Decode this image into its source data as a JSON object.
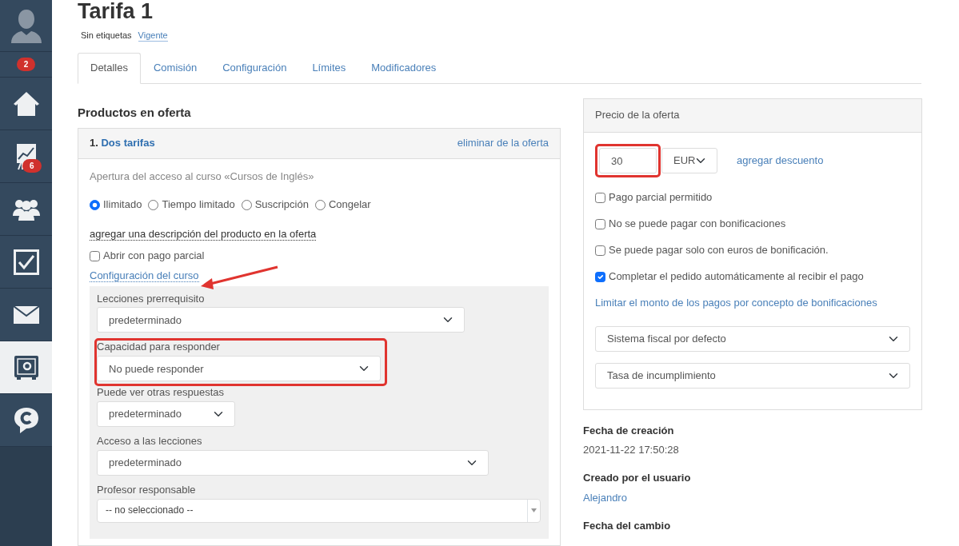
{
  "sidebar": {
    "items": [
      {
        "kind": "avatar",
        "selected": false
      },
      {
        "kind": "counter",
        "badge": "2",
        "selected": false
      },
      {
        "kind": "home",
        "selected": false
      },
      {
        "kind": "chart",
        "badge": "6",
        "selected": false
      },
      {
        "kind": "people",
        "selected": false
      },
      {
        "kind": "tasks",
        "selected": false
      },
      {
        "kind": "mail",
        "selected": false
      },
      {
        "kind": "safe",
        "selected": true
      },
      {
        "kind": "chat",
        "selected": false
      }
    ]
  },
  "title": "Tarifa 1",
  "tags": {
    "label": "Sin etiquetas",
    "status": "Vigente"
  },
  "tabs": [
    {
      "label": "Detalles",
      "selected": true
    },
    {
      "label": "Comisión",
      "selected": false
    },
    {
      "label": "Configuración",
      "selected": false
    },
    {
      "label": "Límites",
      "selected": false
    },
    {
      "label": "Modificadores",
      "selected": false
    }
  ],
  "products": {
    "heading": "Productos en oferta",
    "offer": {
      "number": "1.",
      "name": "Dos tarifas",
      "remove": "eliminar de la oferta",
      "access_text": "Apertura del acceso al curso «Cursos de Inglés»",
      "options": [
        {
          "label": "Ilimitado",
          "selected": true
        },
        {
          "label": "Tiempo limitado",
          "selected": false
        },
        {
          "label": "Suscripción",
          "selected": false
        },
        {
          "label": "Congelar",
          "selected": false
        }
      ],
      "description_link": "agregar una descripción del producto en la oferta",
      "partial": {
        "label": "Abrir con pago parcial",
        "checked": false
      },
      "settings_link": "Configuración del curso",
      "settings": [
        {
          "label": "Lecciones prerrequisito",
          "value": "predeterminado",
          "kind": "select",
          "highlighted": false
        },
        {
          "label": "Capacidad para responder",
          "value": "No puede responder",
          "kind": "select",
          "highlighted": true
        },
        {
          "label": "Puede ver otras respuestas",
          "value": "predeterminado",
          "kind": "select",
          "highlighted": false
        },
        {
          "label": "Acceso a las lecciones",
          "value": "predeterminado",
          "kind": "select",
          "highlighted": false
        },
        {
          "label": "Profesor responsable",
          "value": "-- no seleccionado --",
          "kind": "combo",
          "highlighted": false
        }
      ]
    }
  },
  "price": {
    "heading": "Precio de la oferta",
    "amount": "30",
    "highlighted": true,
    "currency": "EUR",
    "discount_link": "agregar descuento",
    "checks": [
      {
        "label": "Pago parcial permitido",
        "checked": false
      },
      {
        "label": "No se puede pagar con bonificaciones",
        "checked": false
      },
      {
        "label": "Se puede pagar solo con euros de bonificación.",
        "checked": false
      },
      {
        "label": "Completar el pedido automáticamente al recibir el pago",
        "checked": true
      }
    ],
    "limit_link": "Limitar el monto de los pagos por concepto de bonificaciones",
    "selects": [
      "Sistema fiscal por defecto",
      "Tasa de incumplimiento"
    ]
  },
  "meta": [
    {
      "label": "Fecha de creación",
      "value": "2021-11-22 17:50:28",
      "kind": "text"
    },
    {
      "label": "Creado por el usuario",
      "value": "Alejandro",
      "kind": "link"
    },
    {
      "label": "Fecha del cambio"
    }
  ]
}
